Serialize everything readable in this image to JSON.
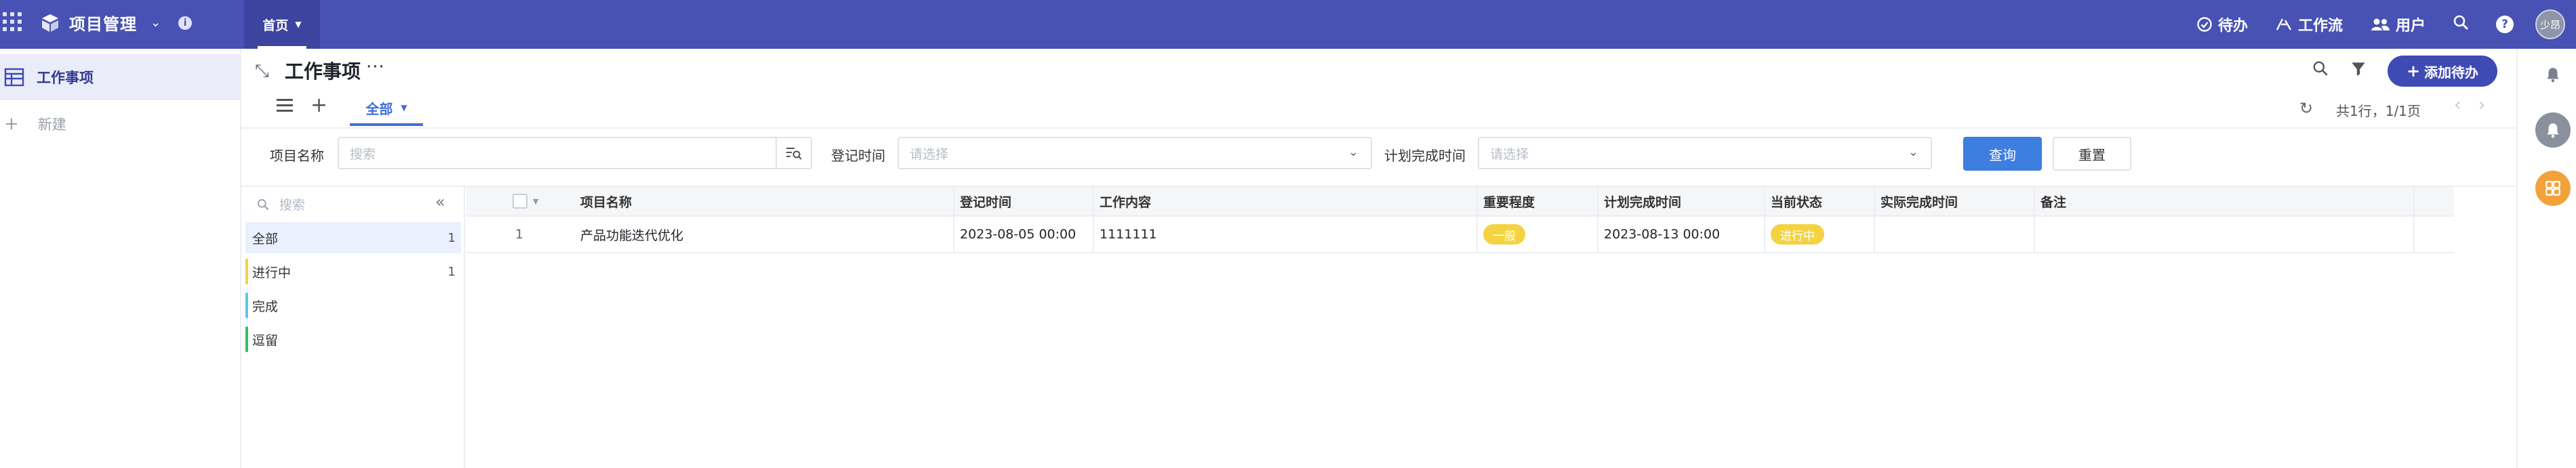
{
  "app": {
    "title": "项目管理",
    "info": "i",
    "home_tab": "首页",
    "colors": {
      "topbar": "#4852b4",
      "accent": "#3f4bb5",
      "query": "#3d7ee0",
      "tag": "#f3d341"
    }
  },
  "topnav": {
    "todo": "待办",
    "workflow": "工作流",
    "users": "用户",
    "help": "?",
    "avatar": "少昂"
  },
  "sidebar": {
    "items": [
      {
        "label": "工作事项",
        "icon": "table-icon"
      }
    ],
    "new_label": "新建"
  },
  "header": {
    "title": "工作事项",
    "more": "···",
    "add_button": "添加待办"
  },
  "views": {
    "active_tab": "全部"
  },
  "pager": {
    "summary": "共1行，1/1页"
  },
  "filters": {
    "project_name_label": "项目名称",
    "project_name_placeholder": "搜索",
    "register_time_label": "登记时间",
    "register_time_placeholder": "请选择",
    "planned_time_label": "计划完成时间",
    "planned_time_placeholder": "请选择",
    "query_button": "查询",
    "reset_button": "重置"
  },
  "status_panel": {
    "search_placeholder": "搜索",
    "items": [
      {
        "label": "全部",
        "count": "1",
        "color": ""
      },
      {
        "label": "进行中",
        "count": "1",
        "color": "#f3d341"
      },
      {
        "label": "完成",
        "count": "",
        "color": "#5fc6e8"
      },
      {
        "label": "逗留",
        "count": "",
        "color": "#34c05a"
      }
    ]
  },
  "table": {
    "columns": [
      "项目名称",
      "登记时间",
      "工作内容",
      "重要程度",
      "计划完成时间",
      "当前状态",
      "实际完成时间",
      "备注"
    ],
    "rows": [
      {
        "index": "1",
        "project_name": "产品功能迭代优化",
        "register_time": "2023-08-05 00:00",
        "content": "1111111",
        "priority": "一般",
        "planned_time": "2023-08-13 00:00",
        "status": "进行中",
        "actual_time": "",
        "remark": ""
      }
    ]
  }
}
